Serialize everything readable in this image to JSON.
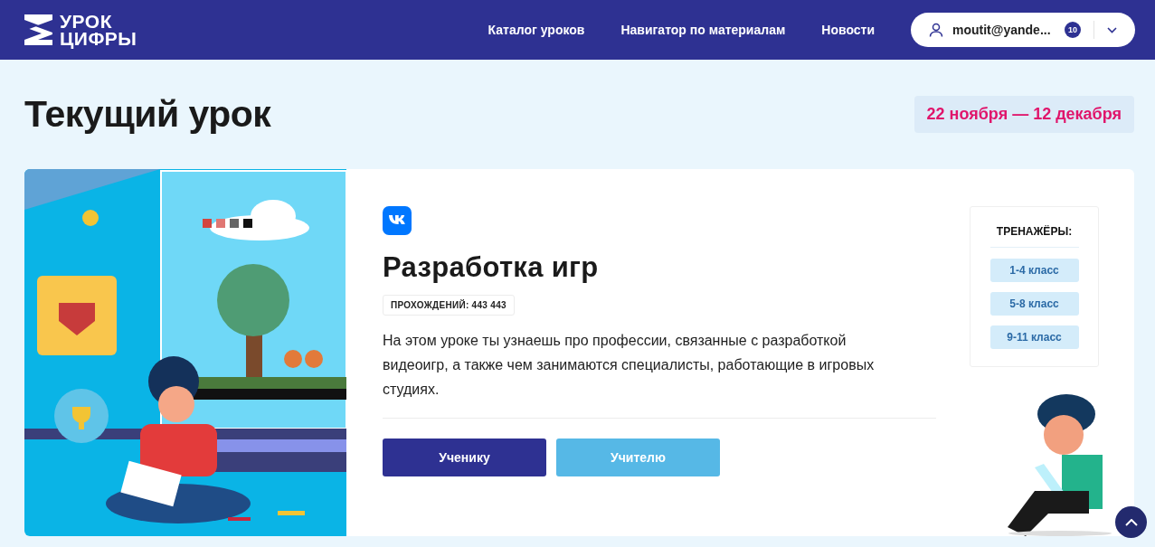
{
  "header": {
    "logo_lines": [
      "УРОК",
      "ЦИФРЫ"
    ],
    "nav": [
      "Каталог уроков",
      "Навигатор по материалам",
      "Новости"
    ],
    "user": {
      "email": "moutit@yande...",
      "count": "10"
    }
  },
  "page_title": "Текущий урок",
  "date_range": "22 ноября — 12 декабря",
  "lesson": {
    "title": "Разработка игр",
    "passes": "ПРОХОЖДЕНИЙ: 443 443",
    "description": "На этом уроке ты узнаешь про профессии, связанные с разработкой видеоигр, а также чем занимаются специалисты, работающие в игровых студиях.",
    "buttons": [
      {
        "label": "Ученику",
        "kind": "primary"
      },
      {
        "label": "Учителю",
        "kind": "secondary"
      }
    ]
  },
  "trainers": {
    "title": "ТРЕНАЖЁРЫ:",
    "items": [
      "1-4 класс",
      "5-8 класс",
      "9-11 класс"
    ]
  }
}
